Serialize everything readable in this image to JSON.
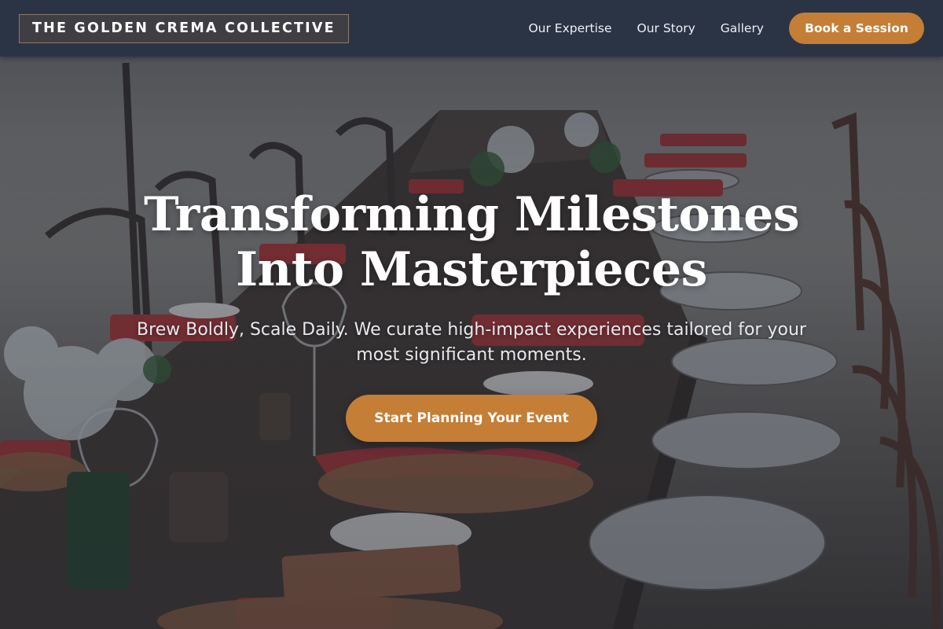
{
  "brand": {
    "name": "THE GOLDEN CREMA COLLECTIVE"
  },
  "nav": {
    "links": [
      {
        "label": "Our Expertise"
      },
      {
        "label": "Our Story"
      },
      {
        "label": "Gallery"
      }
    ],
    "cta_label": "Book a Session"
  },
  "hero": {
    "title_line1": "Transforming Milestones",
    "title_line2": "Into Masterpieces",
    "subtitle": "Brew Boldly, Scale Daily. We curate high-impact experiences tailored for your most significant moments.",
    "cta_label": "Start Planning Your Event",
    "background_image": "outdoor-banquet-table"
  },
  "colors": {
    "header_bg": "#2b3445",
    "accent": "#c47e35",
    "text_light": "#ffffff"
  }
}
